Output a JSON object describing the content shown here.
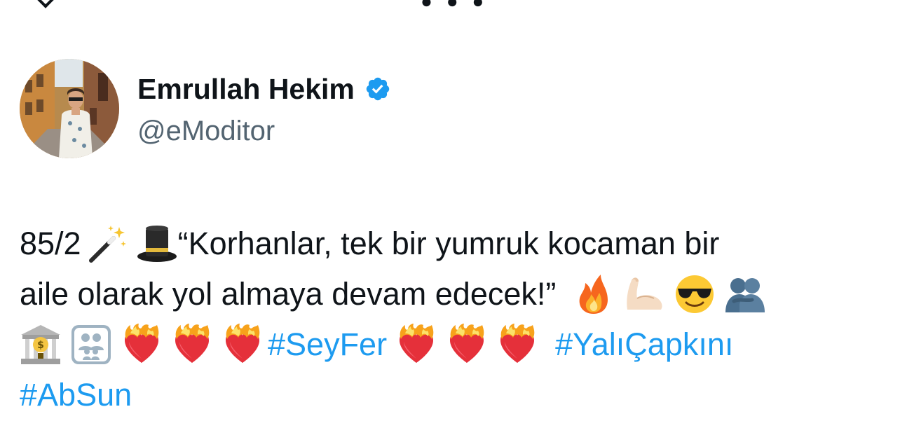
{
  "author": {
    "display_name": "Emrullah Hekim",
    "handle": "@eModitor",
    "verified": true
  },
  "tweet": {
    "line1_text_a": "85/2",
    "line1_text_b": "“Korhanlar, tek bir yumruk kocaman bir",
    "line2_text": "aile olarak yol almaya devam edecek!”",
    "hashtag_1": "#SeyFer",
    "hashtag_2": "#YalıÇapkını",
    "hashtag_3": "#AbSun"
  },
  "icons": {
    "verified": "verified-badge-icon",
    "emojis_line1": [
      "magic-wand-emoji",
      "top-hat-emoji"
    ],
    "emojis_line2": [
      "fire-emoji",
      "flexed-biceps-emoji",
      "sunglasses-face-emoji",
      "people-hugging-emoji"
    ],
    "emojis_line3": [
      "bank-emoji",
      "family-emoji",
      "heart-on-fire-emoji",
      "heart-on-fire-emoji",
      "heart-on-fire-emoji",
      "heart-on-fire-emoji",
      "heart-on-fire-emoji",
      "heart-on-fire-emoji"
    ]
  },
  "colors": {
    "hashtag": "#1d9bf0",
    "handle": "#536471",
    "text": "#0f1419",
    "verified_badge": "#1d9bf0"
  }
}
